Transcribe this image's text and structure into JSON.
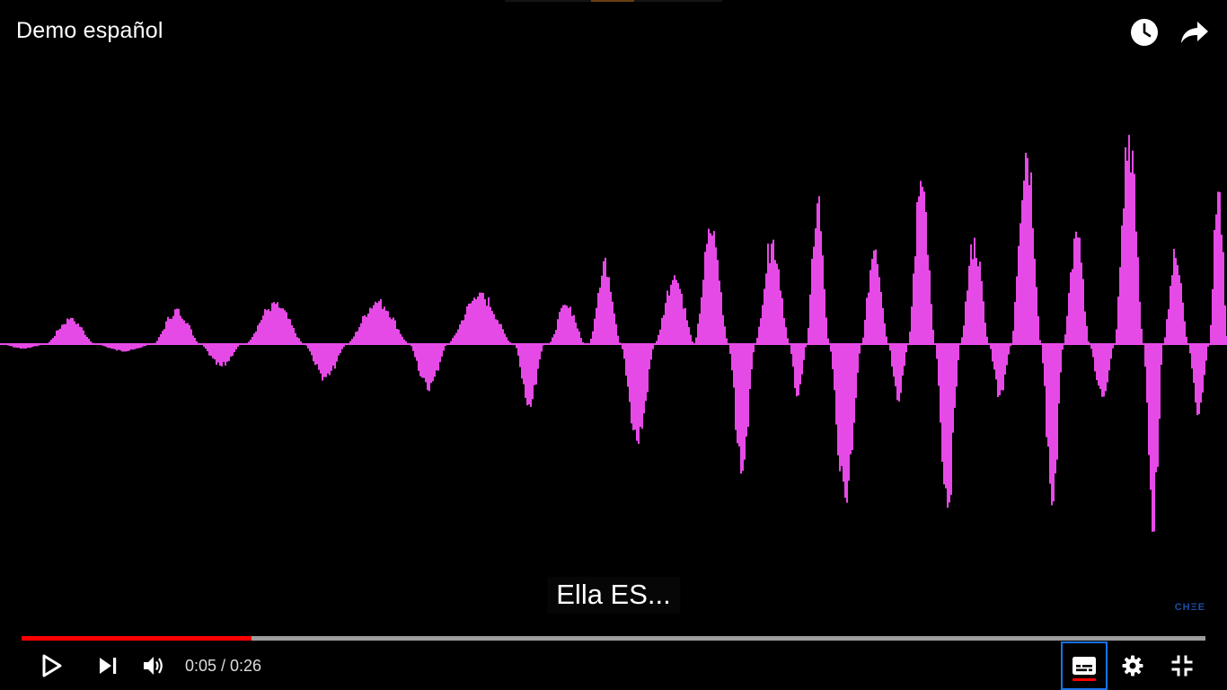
{
  "video": {
    "title": "Demo español",
    "caption": "Ella ES...",
    "watermark": "CHΞE"
  },
  "top_actions": {
    "watch_later_icon": "clock-icon",
    "share_icon": "share-arrow-icon"
  },
  "playback": {
    "current_time": "0:05",
    "duration": "0:26",
    "time_display": "0:05 / 0:26",
    "played_fraction": 0.194,
    "loaded_fraction": 1.0
  },
  "controls": {
    "play_icon": "play-icon",
    "next_icon": "next-track-icon",
    "volume_icon": "volume-icon",
    "subtitles_icon": "subtitles-icon",
    "subtitles_on": true,
    "settings_icon": "gear-icon",
    "fullscreen_icon": "exit-fullscreen-icon"
  },
  "colors": {
    "waveform": "#e64ae6",
    "progress_played": "#ff0000",
    "subtitle_accent": "#ff0000",
    "focus_outline": "#1a73e8"
  }
}
